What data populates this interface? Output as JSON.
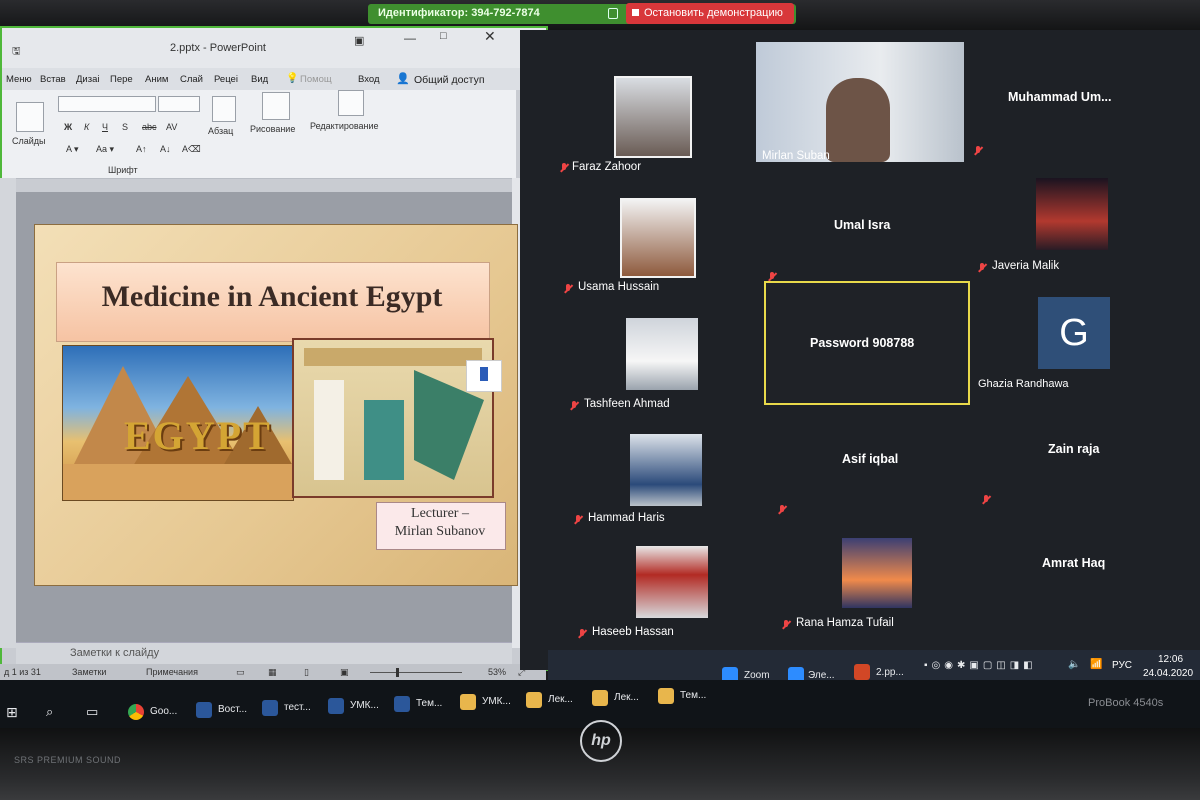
{
  "share_bar": {
    "meeting_id": "Идентификатор: 394-792-7874",
    "stop_label": "Остановить демонстрацию"
  },
  "powerpoint": {
    "file_title": "2.pptx - PowerPoint",
    "tabs": [
      "Меню",
      "Встав",
      "Дизаі",
      "Пере",
      "Аним",
      "Слай",
      "Рецеі",
      "Вид",
      "Помощ",
      "Вход",
      "Общий доступ"
    ],
    "ribbon": {
      "slides_label": "Слайды",
      "font_group": "Шрифт",
      "paragraph_label": "Абзац",
      "drawing_label": "Рисование",
      "editing_label": "Редактирование",
      "font_buttons": [
        "Ж",
        "К",
        "Ч",
        "S",
        "abc",
        "AV"
      ]
    },
    "notes_placeholder": "Заметки к слайду",
    "status": {
      "slide_count": "д 1 из 31",
      "notes_button": "Заметки",
      "comments_button": "Примечания",
      "zoom_percent": "53%"
    },
    "slide": {
      "title": "Medicine in Ancient Egypt",
      "image_word": "EGYPT",
      "lecturer_line1": "Lecturer –",
      "lecturer_line2": "Mirlan Subanov"
    }
  },
  "zoom_gallery": {
    "participants": [
      {
        "name": "Faraz Zahoor",
        "muted": true
      },
      {
        "name": "Mirlan Suban",
        "muted": false
      },
      {
        "name": "Muhammad Um...",
        "muted": true
      },
      {
        "name": "Usama Hussain",
        "muted": true
      },
      {
        "name": "Umal Isra",
        "muted": true
      },
      {
        "name": "Javeria Malik",
        "muted": true
      },
      {
        "name": "Tashfeen Ahmad",
        "muted": true
      },
      {
        "name": "Password 908788",
        "muted": false
      },
      {
        "name": "Ghazia Randhawa",
        "muted": false
      },
      {
        "name": "Hammad Haris",
        "muted": true
      },
      {
        "name": "Asif iqbal",
        "muted": true
      },
      {
        "name": "Zain raja",
        "muted": true
      },
      {
        "name": "Haseeb Hassan",
        "muted": true
      },
      {
        "name": "Rana Hamza Tufail",
        "muted": true
      },
      {
        "name": "Amrat Haq",
        "muted": false
      }
    ],
    "avatar_letter": "G"
  },
  "taskbar": {
    "zoom_items": [
      "Zoom",
      "Эле...",
      "2.pp..."
    ],
    "items": [
      "Goo...",
      "Вост...",
      "тест...",
      "УМК...",
      "Тем...",
      "УМК...",
      "Лек...",
      "Лек...",
      "Тем..."
    ],
    "lang": "РУС",
    "time": "12:06",
    "date": "24.04.2020"
  },
  "device": {
    "brand": "hp",
    "model": "ProBook 4540s",
    "speaker_label": "SRS PREMIUM SOUND"
  }
}
